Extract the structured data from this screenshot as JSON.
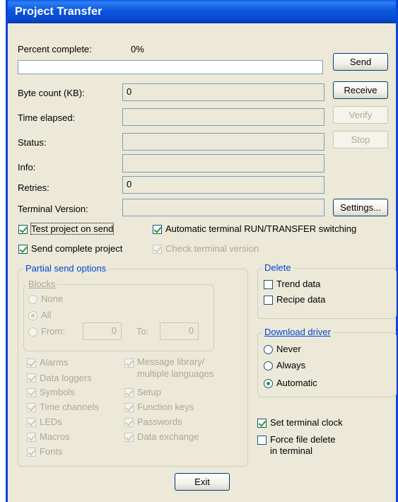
{
  "window": {
    "title": "Project Transfer"
  },
  "progress": {
    "label": "Percent complete:",
    "value_text": "0%",
    "fraction": 0
  },
  "fields": {
    "byte_count": {
      "label": "Byte count (KB):",
      "value": "0"
    },
    "time_elapsed": {
      "label": "Time elapsed:",
      "value": ""
    },
    "status": {
      "label": "Status:",
      "value": ""
    },
    "info": {
      "label": "Info:",
      "value": ""
    },
    "retries": {
      "label": "Retries:",
      "value": "0"
    },
    "terminal_version": {
      "label": "Terminal Version:",
      "value": ""
    }
  },
  "buttons": {
    "send": "Send",
    "receive": "Receive",
    "verify": "Verify",
    "stop": "Stop",
    "settings": "Settings...",
    "exit": "Exit"
  },
  "options": {
    "test_project": "Test project on send",
    "auto_switch": "Automatic terminal RUN/TRANSFER switching",
    "send_complete": "Send complete project",
    "check_version": "Check terminal version"
  },
  "partial": {
    "title": "Partial send options",
    "blocks": {
      "title": "Blocks",
      "none": "None",
      "all": "All",
      "from": "From:",
      "from_value": "0",
      "to": "To:",
      "to_value": "0"
    },
    "items_left": [
      "Alarms",
      "Data loggers",
      "Symbols",
      "Time channels",
      "LEDs",
      "Macros",
      "Fonts"
    ],
    "items_right": [
      "Message library/\nmultiple languages",
      "Setup",
      "Function keys",
      "Passwords",
      "Data exchange"
    ]
  },
  "delete": {
    "title": "Delete",
    "trend": "Trend data",
    "recipe": "Recipe data"
  },
  "driver": {
    "title": "Download driver",
    "never": "Never",
    "always": "Always",
    "automatic": "Automatic",
    "selected": "Automatic"
  },
  "clock": {
    "set_clock": "Set terminal clock",
    "force_delete_1": "Force file delete",
    "force_delete_2": "in terminal"
  },
  "colors": {
    "titlebar": "#0a46d6",
    "window_bg": "#ece9d8",
    "group_title": "#0046d5",
    "check_mark": "#21a121",
    "disabled_text": "#aca899"
  }
}
